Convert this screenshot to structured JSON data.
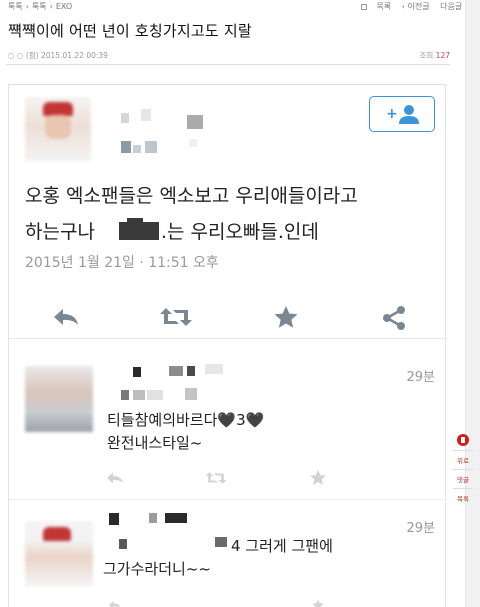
{
  "breadcrumb": {
    "items": [
      "톡톡",
      "›",
      "톡톡",
      "›",
      "EXO"
    ],
    "right": {
      "list_label": "목록",
      "prev_label": "‹ 이전글",
      "next_label": "다음글 ›"
    }
  },
  "post": {
    "title": "쨱쨱이에 어떤 년이 호칭가지고도 지랄",
    "author_meta": "○ ○ (펌)   2015.01.22 00:39",
    "views_label": "조회",
    "views_count": "127"
  },
  "side_menu": {
    "items": [
      "위로",
      "댓글",
      "목록"
    ]
  },
  "tweet": {
    "text_line1": "오홍 엑소팬들은 엑소보고 우리애들이라고",
    "text_line2_pre": "하는구나",
    "text_line2_post": ".는 우리오빠들.인데",
    "date": "2015년 1월 21일 · 11:51 오후"
  },
  "icons": {
    "follow": "add-user-icon",
    "reply": "reply-icon",
    "retweet": "retweet-icon",
    "favorite": "star-icon",
    "share": "share-icon"
  },
  "replies": [
    {
      "time": "29분",
      "line1": "티들참예의바르다🖤3🖤",
      "line2": "완전내스타일~"
    },
    {
      "time": "29분",
      "line1": "4 그러게 그팬에",
      "line2": "그가수라더니~~"
    }
  ],
  "colors": {
    "accent": "#3b94d9",
    "icon_gray": "#7a8691",
    "views_red": "#c44444",
    "side_logo": "#d41c1c"
  }
}
